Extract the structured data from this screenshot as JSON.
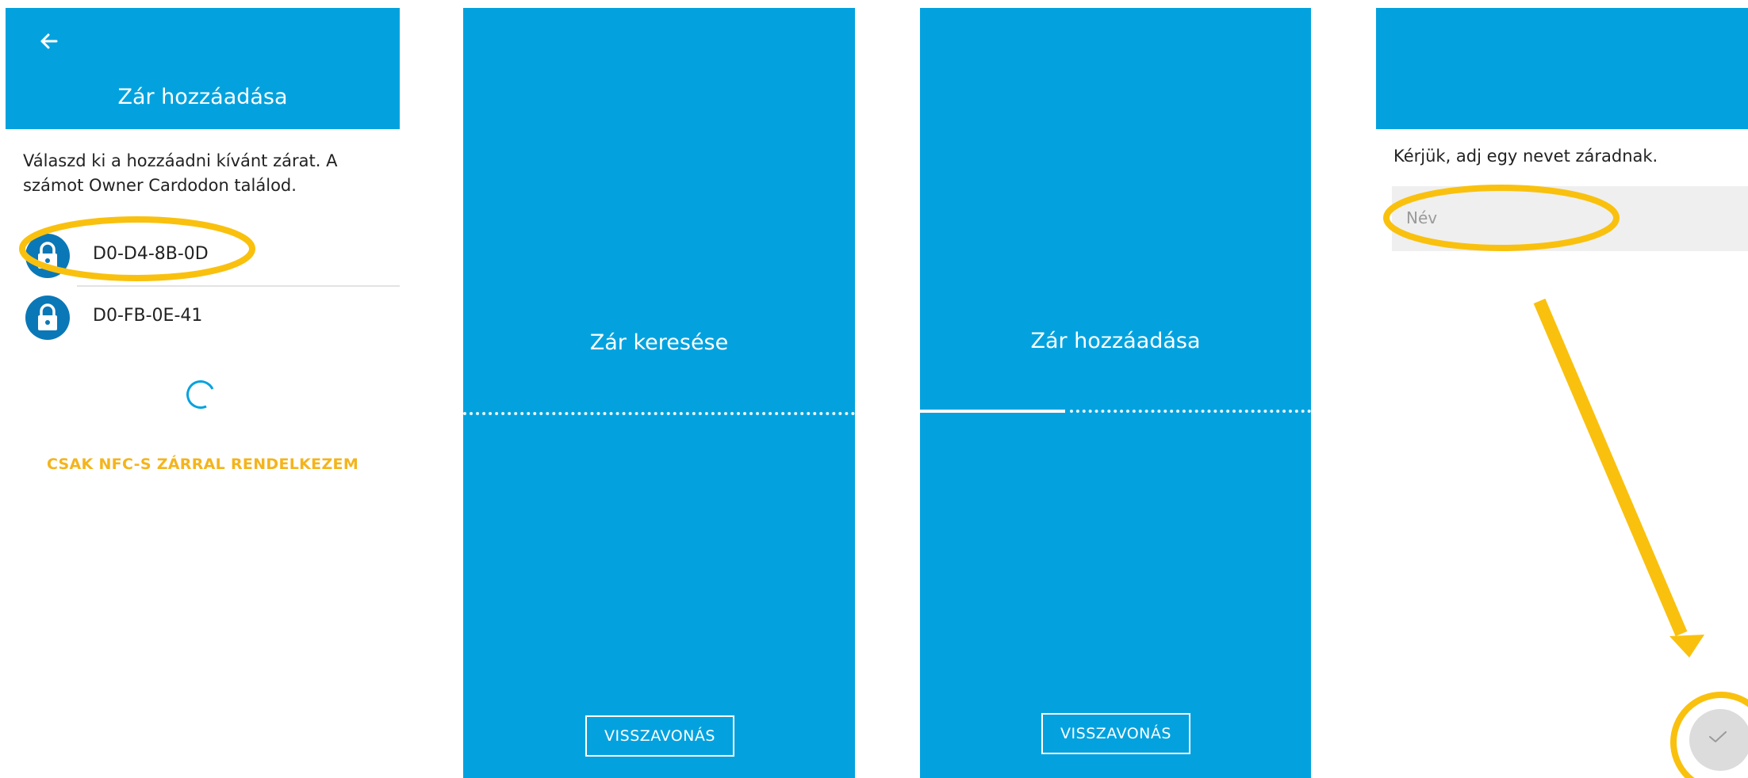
{
  "panels": {
    "select_lock": {
      "title": "Zár hozzáadása",
      "description": "Válaszd ki a hozzáadni kívánt zárat. A számot Owner Cardodon találod.",
      "locks": [
        {
          "label": "D0-D4-8B-0D",
          "icon": "lock-icon"
        },
        {
          "label": "D0-FB-0E-41",
          "icon": "lock-icon"
        }
      ],
      "nfc_link": "CSAK NFC-S ZÁRRAL RENDELKEZEM"
    },
    "searching": {
      "status": "Zár keresése",
      "cancel": "VISSZAVONÁS"
    },
    "adding": {
      "status": "Zár hozzáadása",
      "cancel": "VISSZAVONÁS"
    },
    "naming": {
      "prompt": "Kérjük, adj egy nevet záradnak.",
      "name_placeholder": "Név",
      "confirm_icon": "check-icon"
    }
  },
  "colors": {
    "primary": "#03a2df",
    "lock_circle": "#0a78b7",
    "link": "#f4b41c",
    "highlight": "#f9c10e"
  }
}
